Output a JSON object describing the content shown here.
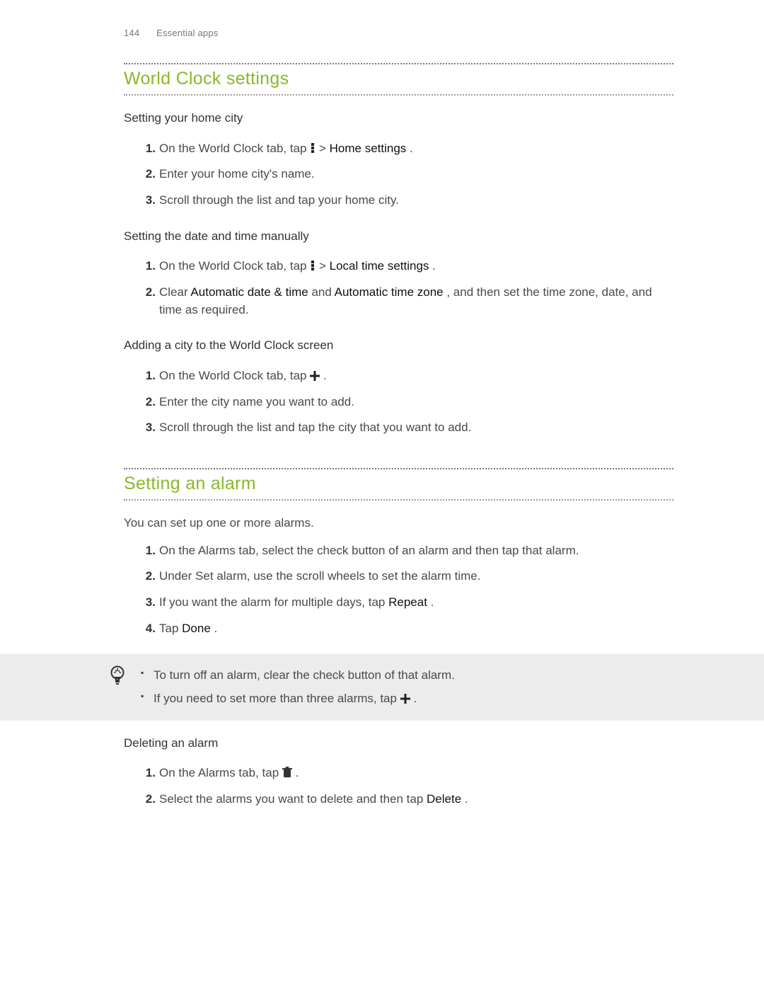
{
  "header": {
    "page_number": "144",
    "section_label": "Essential apps"
  },
  "section1": {
    "title": "World Clock settings",
    "sub_a": {
      "heading": "Setting your home city",
      "steps": [
        {
          "pre": "On the World Clock tab, tap ",
          "icon": "more",
          "mid": " > ",
          "kw": "Home settings",
          "post": "."
        },
        {
          "pre": "Enter your home city's name.",
          "icon": null
        },
        {
          "pre": "Scroll through the list and tap your home city.",
          "icon": null
        }
      ]
    },
    "sub_b": {
      "heading": "Setting the date and time manually",
      "steps": [
        {
          "pre": "On the World Clock tab, tap ",
          "icon": "more",
          "mid": " > ",
          "kw": "Local time settings",
          "post": "."
        },
        {
          "pre": "Clear ",
          "kw": "Automatic date & time",
          "mid2": " and ",
          "kw2": "Automatic time zone",
          "post": ", and then set the time zone, date, and time as required.",
          "icon": null
        }
      ]
    },
    "sub_c": {
      "heading": "Adding a city to the World Clock screen",
      "steps": [
        {
          "pre": "On the World Clock tab, tap ",
          "icon": "plus",
          "post": "."
        },
        {
          "pre": "Enter the city name you want to add.",
          "icon": null
        },
        {
          "pre": "Scroll through the list and tap the city that you want to add.",
          "icon": null
        }
      ]
    }
  },
  "section2": {
    "title": "Setting an alarm",
    "intro": "You can set up one or more alarms.",
    "steps": [
      {
        "pre": "On the Alarms tab, select the check button of an alarm and then tap that alarm."
      },
      {
        "pre": "Under Set alarm, use the scroll wheels to set the alarm time."
      },
      {
        "pre": "If you want the alarm for multiple days, tap ",
        "kw": "Repeat",
        "post": "."
      },
      {
        "pre": "Tap ",
        "kw": "Done",
        "post": "."
      }
    ],
    "tips": [
      {
        "text": "To turn off an alarm, clear the check button of that alarm."
      },
      {
        "pre": "If you need to set more than three alarms, tap ",
        "icon": "plus",
        "post": "."
      }
    ],
    "sub_delete": {
      "heading": "Deleting an alarm",
      "steps": [
        {
          "pre": "On the Alarms tab, tap ",
          "icon": "trash",
          "post": "."
        },
        {
          "pre": "Select the alarms you want to delete and then tap ",
          "kw": "Delete",
          "post": "."
        }
      ]
    }
  }
}
